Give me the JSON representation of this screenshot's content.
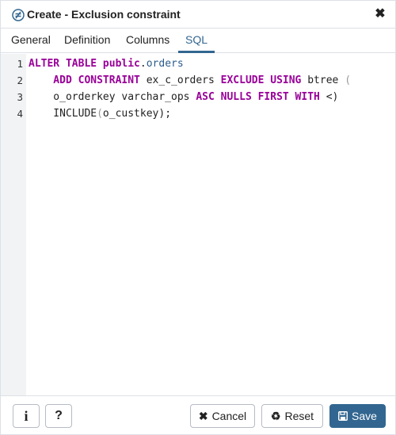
{
  "dialog": {
    "title": "Create - Exclusion constraint",
    "close_glyph": "✖"
  },
  "tabs": [
    {
      "label": "General"
    },
    {
      "label": "Definition"
    },
    {
      "label": "Columns"
    },
    {
      "label": "SQL",
      "active": true
    }
  ],
  "editor": {
    "line_numbers": [
      "1",
      "2",
      "3",
      "4"
    ],
    "lines": [
      [
        {
          "t": "ALTER TABLE ",
          "c": "kw"
        },
        {
          "t": "public",
          "c": "kw"
        },
        {
          "t": ".",
          "c": ""
        },
        {
          "t": "orders",
          "c": "id"
        }
      ],
      [
        {
          "t": "    ADD CONSTRAINT ",
          "c": "kw"
        },
        {
          "t": "ex_c_orders ",
          "c": ""
        },
        {
          "t": "EXCLUDE USING ",
          "c": "kw"
        },
        {
          "t": "btree ",
          "c": ""
        },
        {
          "t": "(",
          "c": "br"
        }
      ],
      [
        {
          "t": "    o_orderkey varchar_ops ",
          "c": ""
        },
        {
          "t": "ASC NULLS FIRST WITH ",
          "c": "kw"
        },
        {
          "t": "<)",
          "c": ""
        }
      ],
      [
        {
          "t": "    INCLUDE",
          "c": ""
        },
        {
          "t": "(",
          "c": "br"
        },
        {
          "t": "o_custkey",
          "c": ""
        },
        {
          "t": ");",
          "c": ""
        }
      ]
    ]
  },
  "footer": {
    "info_label": "i",
    "help_label": "?",
    "cancel_label": "Cancel",
    "reset_label": "Reset",
    "save_label": "Save"
  },
  "colors": {
    "accent": "#326690",
    "keyword": "#990099",
    "identifier": "#2c5c8c"
  }
}
